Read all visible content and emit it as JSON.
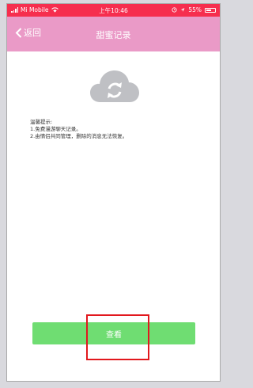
{
  "status_bar": {
    "carrier": "Mi Mobile",
    "time": "上午10:46",
    "battery": "55%"
  },
  "nav": {
    "back_label": "返回",
    "title": "甜蜜记录"
  },
  "tips": {
    "heading": "温馨提示:",
    "line1": "1.免费漫游聊天记录。",
    "line2": "2.由情侣共同管理，删除的消息无法恢复。"
  },
  "actions": {
    "view_label": "查看"
  },
  "icons": {
    "cloud": "cloud-sync-icon",
    "back": "chevron-left-icon"
  },
  "colors": {
    "status_bar": "#f62e4e",
    "nav_bar": "#ea9ac7",
    "button": "#6fdd72",
    "highlight": "#e2181d",
    "cloud": "#bfc0c4"
  }
}
